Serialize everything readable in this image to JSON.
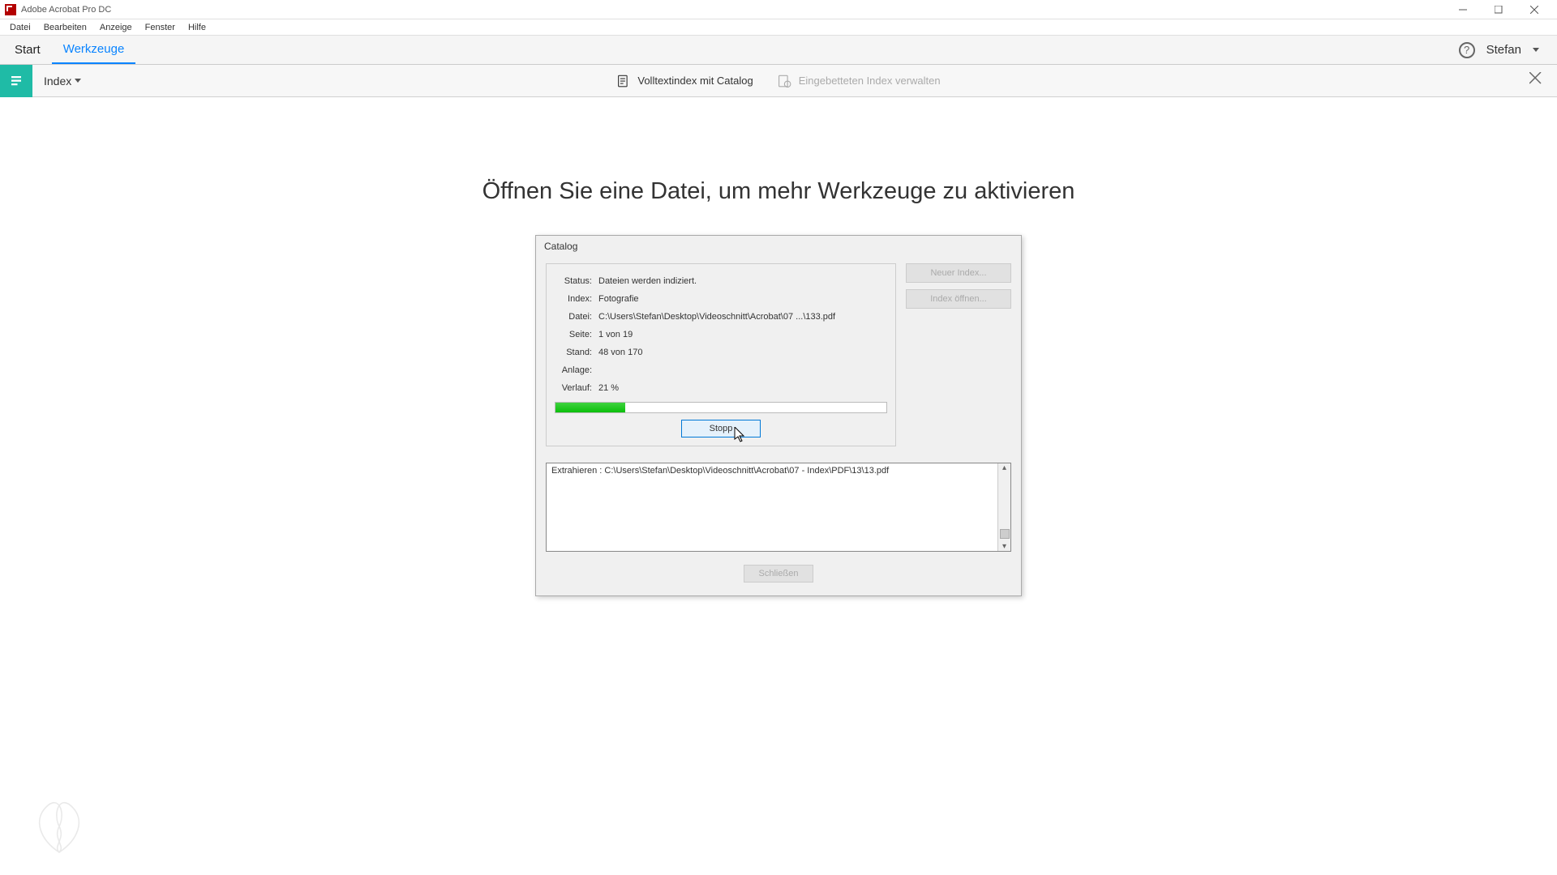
{
  "app": {
    "title": "Adobe Acrobat Pro DC"
  },
  "menu": {
    "items": [
      "Datei",
      "Bearbeiten",
      "Anzeige",
      "Fenster",
      "Hilfe"
    ]
  },
  "tabs": {
    "start": "Start",
    "werkzeuge": "Werkzeuge"
  },
  "user": {
    "name": "Stefan"
  },
  "toolbar": {
    "index_label": "Index",
    "volltext": "Volltextindex mit Catalog",
    "eingebettet": "Eingebetteten Index verwalten"
  },
  "main": {
    "heading": "Öffnen Sie eine Datei, um mehr Werkzeuge zu aktivieren"
  },
  "dialog": {
    "title": "Catalog",
    "labels": {
      "status": "Status:",
      "index": "Index:",
      "datei": "Datei:",
      "seite": "Seite:",
      "stand": "Stand:",
      "anlage": "Anlage:",
      "verlauf": "Verlauf:"
    },
    "values": {
      "status": "Dateien werden indiziert.",
      "index": "Fotografie",
      "datei": "C:\\Users\\Stefan\\Desktop\\Videoschnitt\\Acrobat\\07 ...\\133.pdf",
      "seite": "1 von 19",
      "stand": "48 von 170",
      "anlage": "",
      "verlauf": "21 %"
    },
    "progress_percent": 21,
    "stop": "Stopp",
    "neuer_index": "Neuer Index...",
    "index_oeffnen": "Index öffnen...",
    "log": "Extrahieren : C:\\Users\\Stefan\\Desktop\\Videoschnitt\\Acrobat\\07 - Index\\PDF\\13\\13.pdf",
    "schliessen": "Schließen"
  }
}
